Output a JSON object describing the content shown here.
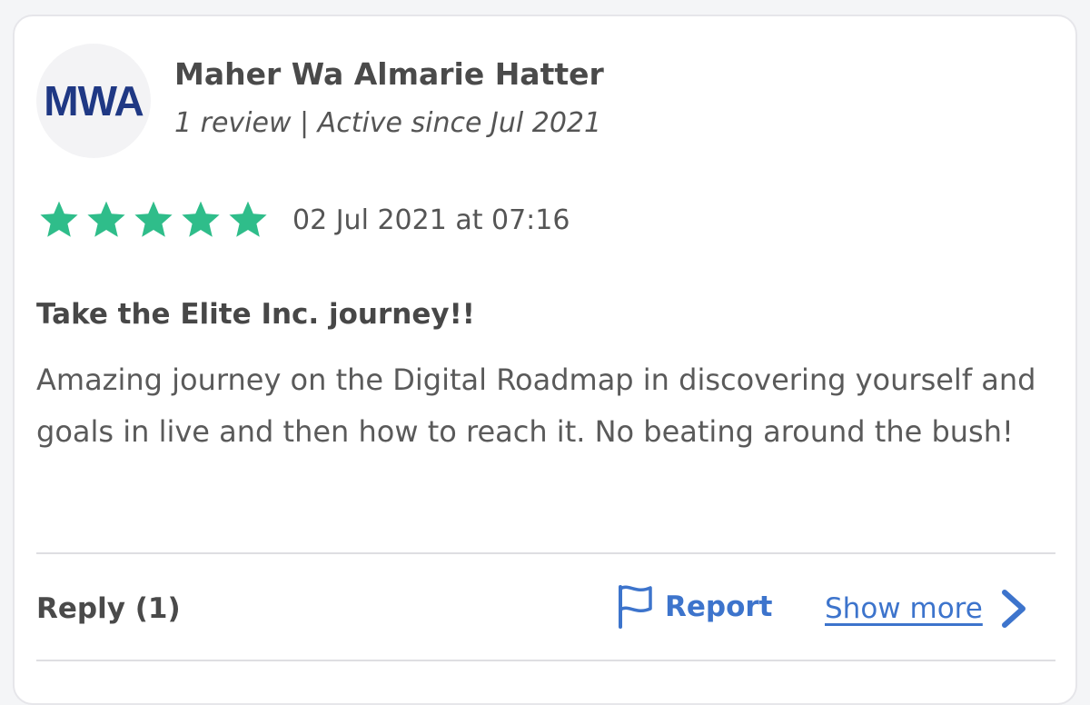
{
  "reviewer": {
    "initials": "MWA",
    "name": "Maher Wa Almarie Hatter",
    "meta": "1 review | Active since Jul 2021"
  },
  "review": {
    "rating": 5,
    "max_rating": 5,
    "date": "02 Jul 2021 at 07:16",
    "title": "Take the Elite Inc. journey!!",
    "body": "Amazing journey on the Digital Roadmap in discovering yourself and goals in live and then how to reach it. No beating around the bush!"
  },
  "actions": {
    "reply_label": "Reply (1)",
    "report_label": "Report",
    "show_more_label": "Show more"
  },
  "icons": {
    "star": "star-icon",
    "report": "flag-icon",
    "show_more": "chevron-right-icon"
  },
  "colors": {
    "avatar_text": "#1f3884",
    "star": "#2fbd8a",
    "link": "#3d74cc",
    "text": "#4a4a4a"
  }
}
